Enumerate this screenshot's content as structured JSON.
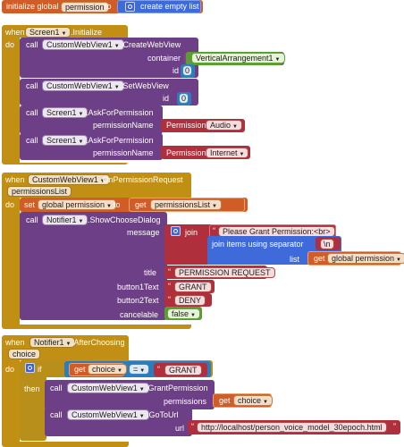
{
  "colors": {
    "variable": "#d05c27",
    "procedure": "#6d3f86",
    "event": "#c08f13",
    "component": "#7c477e",
    "text": "#b02f3c",
    "list": "#3f6ad9",
    "logic": "#5c9c34",
    "math": "#2d7dbc",
    "control": "#b98f1c"
  },
  "block1": {
    "prefix": "initialize global",
    "var": "permission",
    "to": "to",
    "list_label": "create empty list"
  },
  "block2": {
    "when": "when",
    "comp": "Screen1",
    "event": ".Initialize",
    "do": "do",
    "c1": {
      "call": "call",
      "comp": "CustomWebView1",
      "method": ".CreateWebView",
      "p1": "container",
      "v1": "VerticalArrangement1",
      "p2": "id",
      "v2": "0"
    },
    "c2": {
      "call": "call",
      "comp": "CustomWebView1",
      "method": ".SetWebView",
      "p1": "id",
      "v1": "0"
    },
    "c3": {
      "call": "call",
      "comp": "Screen1",
      "method": ".AskForPermission",
      "p1": "permissionName",
      "enum": "Permission",
      "val": "Audio"
    },
    "c4": {
      "call": "call",
      "comp": "Screen1",
      "method": ".AskForPermission",
      "p1": "permissionName",
      "enum": "Permission",
      "val": "Internet"
    }
  },
  "block3": {
    "when": "when",
    "comp": "CustomWebView1",
    "event": ".OnPermissionRequest",
    "param": "permissionsList",
    "do": "do",
    "set": {
      "set": "set",
      "var": "global permission",
      "to": "to",
      "get": "get",
      "getvar": "permissionsList"
    },
    "call": {
      "call": "call",
      "comp": "Notifier1",
      "method": ".ShowChooseDialog",
      "message": "message",
      "join": "join",
      "s1": "Please Grant Permission:<br>",
      "joinsep": "join items using separator",
      "sep": "\\n",
      "list": "list",
      "get": "get",
      "getvar": "global permission",
      "title": "title",
      "title_v": "PERMISSION REQUEST",
      "b1": "button1Text",
      "b1_v": "GRANT",
      "b2": "button2Text",
      "b2_v": "DENY",
      "cancel": "cancelable",
      "cancel_v": "false"
    }
  },
  "block4": {
    "when": "when",
    "comp": "Notifier1",
    "event": ".AfterChoosing",
    "param": "choice",
    "do": "do",
    "if": "if",
    "get": "get",
    "getvar": "choice",
    "op": "=",
    "cmp": "GRANT",
    "then": "then",
    "c1": {
      "call": "call",
      "comp": "CustomWebView1",
      "method": ".GrantPermission",
      "p1": "permissions",
      "get": "get",
      "getvar": "choice"
    },
    "c2": {
      "call": "call",
      "comp": "CustomWebView1",
      "method": ".GoToUrl",
      "p1": "url",
      "v1": "http://localhost/person_voice_model_30epoch.html"
    }
  }
}
